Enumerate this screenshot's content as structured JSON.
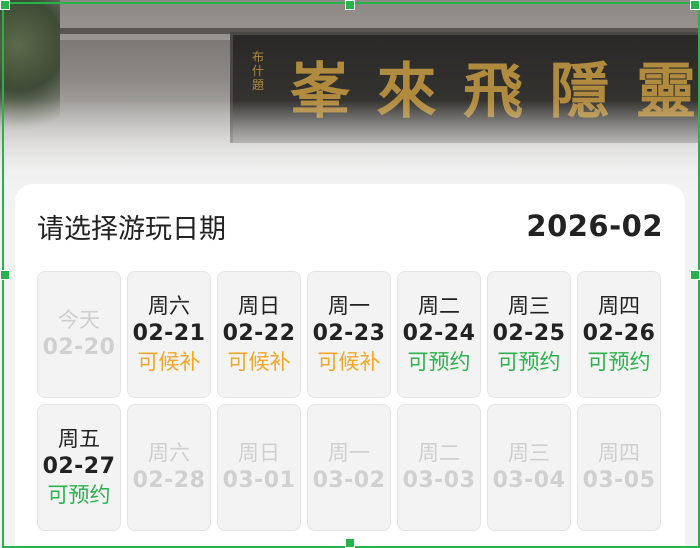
{
  "banner": {
    "plaque_chars": [
      "靈",
      "隱",
      "飛",
      "來",
      "峯"
    ],
    "seal_text": "布什題"
  },
  "card": {
    "title": "请选择游玩日期",
    "month": "2026-02"
  },
  "days": [
    {
      "weekday": "今天",
      "date": "02-20",
      "status": "",
      "state": "disabled"
    },
    {
      "weekday": "周六",
      "date": "02-21",
      "status": "可候补",
      "state": "wait"
    },
    {
      "weekday": "周日",
      "date": "02-22",
      "status": "可候补",
      "state": "wait"
    },
    {
      "weekday": "周一",
      "date": "02-23",
      "status": "可候补",
      "state": "wait"
    },
    {
      "weekday": "周二",
      "date": "02-24",
      "status": "可预约",
      "state": "ok"
    },
    {
      "weekday": "周三",
      "date": "02-25",
      "status": "可预约",
      "state": "ok"
    },
    {
      "weekday": "周四",
      "date": "02-26",
      "status": "可预约",
      "state": "ok"
    },
    {
      "weekday": "周五",
      "date": "02-27",
      "status": "可预约",
      "state": "ok"
    },
    {
      "weekday": "周六",
      "date": "02-28",
      "status": "",
      "state": "disabled"
    },
    {
      "weekday": "周日",
      "date": "03-01",
      "status": "",
      "state": "disabled"
    },
    {
      "weekday": "周一",
      "date": "03-02",
      "status": "",
      "state": "disabled"
    },
    {
      "weekday": "周二",
      "date": "03-03",
      "status": "",
      "state": "disabled"
    },
    {
      "weekday": "周三",
      "date": "03-04",
      "status": "",
      "state": "disabled"
    },
    {
      "weekday": "周四",
      "date": "03-05",
      "status": "",
      "state": "disabled"
    }
  ],
  "colors": {
    "status_wait": "#f5a623",
    "status_ok": "#2bb24c",
    "selection_frame": "#28b34a"
  }
}
